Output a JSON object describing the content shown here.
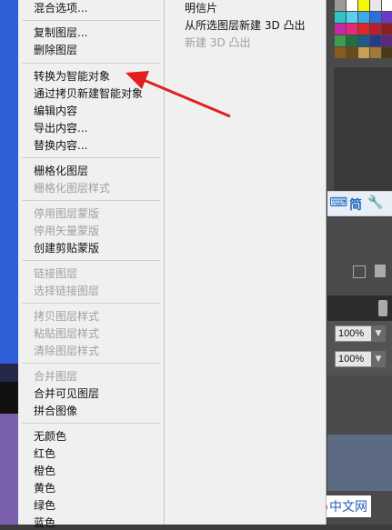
{
  "main_menu": {
    "items": [
      {
        "label": "混合选项...",
        "disabled": false
      },
      {
        "label": "复制图层...",
        "disabled": false
      },
      {
        "label": "删除图层",
        "disabled": false
      },
      {
        "label": "转换为智能对象",
        "disabled": false
      },
      {
        "label": "通过拷贝新建智能对象",
        "disabled": false
      },
      {
        "label": "编辑内容",
        "disabled": false
      },
      {
        "label": "导出内容...",
        "disabled": false
      },
      {
        "label": "替换内容...",
        "disabled": false
      },
      {
        "label": "栅格化图层",
        "disabled": false
      },
      {
        "label": "栅格化图层样式",
        "disabled": true
      },
      {
        "label": "停用图层蒙版",
        "disabled": true
      },
      {
        "label": "停用矢量蒙版",
        "disabled": true
      },
      {
        "label": "创建剪贴蒙版",
        "disabled": false
      },
      {
        "label": "链接图层",
        "disabled": true
      },
      {
        "label": "选择链接图层",
        "disabled": true
      },
      {
        "label": "拷贝图层样式",
        "disabled": true
      },
      {
        "label": "粘贴图层样式",
        "disabled": true
      },
      {
        "label": "清除图层样式",
        "disabled": true
      },
      {
        "label": "合并图层",
        "disabled": true
      },
      {
        "label": "合并可见图层",
        "disabled": false
      },
      {
        "label": "拼合图像",
        "disabled": false
      },
      {
        "label": "无颜色",
        "disabled": false
      },
      {
        "label": "红色",
        "disabled": false
      },
      {
        "label": "橙色",
        "disabled": false
      },
      {
        "label": "黄色",
        "disabled": false
      },
      {
        "label": "绿色",
        "disabled": false
      },
      {
        "label": "蓝色",
        "disabled": false
      }
    ]
  },
  "sub_menu": {
    "items": [
      {
        "label": "明信片",
        "disabled": false
      },
      {
        "label": "从所选图层新建 3D 凸出",
        "disabled": false
      },
      {
        "label": "新建 3D 凸出",
        "disabled": true
      }
    ]
  },
  "ime_bar": {
    "keyboard_icon": "keyboard-icon",
    "lang": "简",
    "wrench_icon": "wrench-icon"
  },
  "layers_panel": {
    "opacity": "100%",
    "fill": "100%"
  },
  "watermark": {
    "badge": "php",
    "text": "中文网"
  },
  "colors": {
    "swatches": [
      "#9a9a9a",
      "#ffffff",
      "#f7f700",
      "#e8e8e8",
      "#ffffff",
      "#2ec4c4",
      "#56d0ee",
      "#3ba8e8",
      "#2e70d8",
      "#6a3ac6",
      "#c828a8",
      "#e82878",
      "#e02828",
      "#b82030",
      "#8a2020",
      "#3e9e4e",
      "#207040",
      "#1e5a8a",
      "#2a3a8a",
      "#5a2a7a",
      "#8a5a20",
      "#6a4a1a",
      "#c8a050",
      "#a07838",
      "#4a3a1a"
    ]
  }
}
